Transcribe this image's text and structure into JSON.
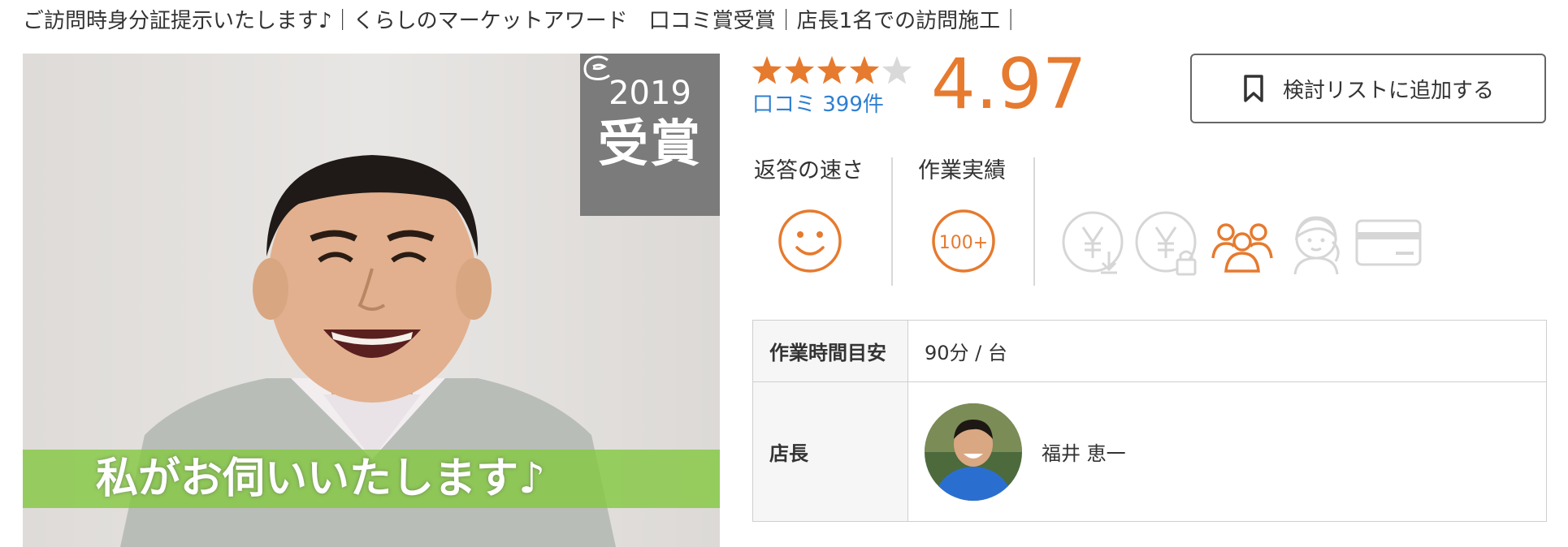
{
  "header": {
    "tagline": "ご訪問時身分証提示いたします♪｜くらしのマーケットアワード　口コミ賞受賞｜店長1名での訪問施工｜"
  },
  "hero": {
    "award_year": "2019",
    "award_label": "受賞",
    "banner_text": "私がお伺いいたします♪"
  },
  "rating": {
    "score": "4.97",
    "stars_filled": 4,
    "stars_total": 5,
    "review_count": "口コミ 399件",
    "accent_color": "#e67a2e",
    "link_color": "#2f7fd1"
  },
  "wishlist": {
    "label": "検討リストに追加する",
    "icon": "bookmark-icon"
  },
  "metrics": [
    {
      "heading": "返答の速さ",
      "icon": "smiley-icon"
    },
    {
      "heading": "作業実績",
      "icon": "100-plus-badge-icon",
      "badge_text": "100+"
    }
  ],
  "badges": [
    {
      "icon": "yen-discount-icon",
      "active": false
    },
    {
      "icon": "yen-lock-icon",
      "active": false
    },
    {
      "icon": "group-icon",
      "active": true
    },
    {
      "icon": "female-staff-icon",
      "active": false
    },
    {
      "icon": "credit-card-icon",
      "active": false
    }
  ],
  "info_table": {
    "rows": [
      {
        "key": "作業時間目安",
        "value": "90分 / 台"
      },
      {
        "key": "店長",
        "value": "福井 恵一"
      }
    ]
  }
}
